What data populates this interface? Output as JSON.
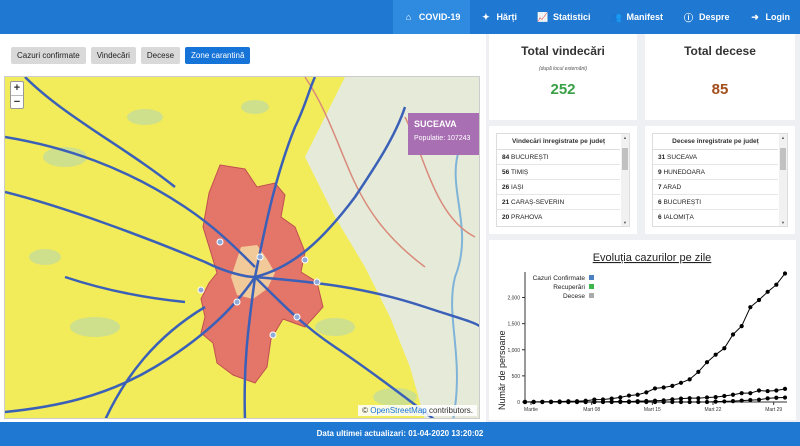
{
  "nav": {
    "items": [
      {
        "label": "COVID-19",
        "icon": "home-icon",
        "glyph": "⌂"
      },
      {
        "label": "Hărți",
        "icon": "compass-icon",
        "glyph": "✦"
      },
      {
        "label": "Statistici",
        "icon": "chart-icon",
        "glyph": "📈"
      },
      {
        "label": "Manifest",
        "icon": "users-icon",
        "glyph": "👥"
      },
      {
        "label": "Despre",
        "icon": "info-icon",
        "glyph": "ⓘ"
      },
      {
        "label": "Login",
        "icon": "login-icon",
        "glyph": "➜"
      }
    ]
  },
  "tabs": [
    "Cazuri confirmate",
    "Vindecări",
    "Decese",
    "Zone carantină"
  ],
  "map": {
    "zoom_in": "+",
    "zoom_out": "−",
    "region": {
      "name": "SUCEAVA",
      "population": "Populatie: 107243",
      "color": "#a86fb3"
    },
    "attribution_prefix": "©",
    "attribution_link": "OpenStreetMap",
    "attribution_suffix": "contributors."
  },
  "stats": {
    "recovered": {
      "title": "Total vindecări",
      "note": "(după locul externării)",
      "value": "252",
      "color": "#3aa046"
    },
    "deaths": {
      "title": "Total decese",
      "value": "85",
      "color": "#a24d1a"
    }
  },
  "recovered_list": {
    "header": "Vindecări înregistrate pe județ",
    "rows": [
      {
        "count": "84",
        "county": "BUCUREȘTI"
      },
      {
        "count": "56",
        "county": "TIMIȘ"
      },
      {
        "count": "26",
        "county": "IAȘI"
      },
      {
        "count": "21",
        "county": "CARAȘ-SEVERIN"
      },
      {
        "count": "20",
        "county": "PRAHOVA"
      }
    ]
  },
  "deaths_list": {
    "header": "Decese înregistrate pe județ",
    "rows": [
      {
        "count": "31",
        "county": "SUCEAVA"
      },
      {
        "count": "9",
        "county": "HUNEDOARA"
      },
      {
        "count": "7",
        "county": "ARAD"
      },
      {
        "count": "6",
        "county": "BUCUREȘTI"
      },
      {
        "count": "6",
        "county": "IALOMIȚA"
      }
    ]
  },
  "chart_data": {
    "type": "line",
    "title": "Evoluția cazurilor pe zile",
    "ylabel": "Număr de persoane",
    "xlabel": "",
    "x_tick_labels": [
      "Martie",
      "Mart 08",
      "Mart 15",
      "Mart 22",
      "Mart 29"
    ],
    "y_ticks": [
      0,
      500,
      1000,
      1500,
      2000
    ],
    "ylim": [
      0,
      2450
    ],
    "legend_position": "top-left",
    "series": [
      {
        "name": "Cazuri Confirmate",
        "color": "#4a80c0",
        "values": [
          3,
          3,
          4,
          6,
          9,
          15,
          15,
          25,
          45,
          49,
          64,
          89,
          123,
          139,
          184,
          260,
          277,
          308,
          367,
          433,
          576,
          762,
          906,
          1029,
          1292,
          1452,
          1815,
          1952,
          2109,
          2245,
          2460
        ]
      },
      {
        "name": "Recuperări",
        "color": "#3cb54a",
        "values": [
          0,
          0,
          0,
          0,
          0,
          0,
          0,
          0,
          2,
          3,
          6,
          9,
          9,
          16,
          19,
          25,
          31,
          51,
          64,
          73,
          73,
          86,
          94,
          115,
          139,
          169,
          169,
          220,
          209,
          220,
          252
        ]
      },
      {
        "name": "Decese",
        "color": "#aaaaaa",
        "values": [
          0,
          0,
          0,
          0,
          0,
          0,
          0,
          0,
          0,
          0,
          0,
          0,
          0,
          0,
          0,
          0,
          0,
          0,
          0,
          0,
          0,
          0,
          7,
          11,
          17,
          26,
          37,
          44,
          69,
          82,
          85
        ]
      }
    ]
  },
  "footer": {
    "text": "Data ultimei actualizari: 01-04-2020 13:20:02"
  }
}
